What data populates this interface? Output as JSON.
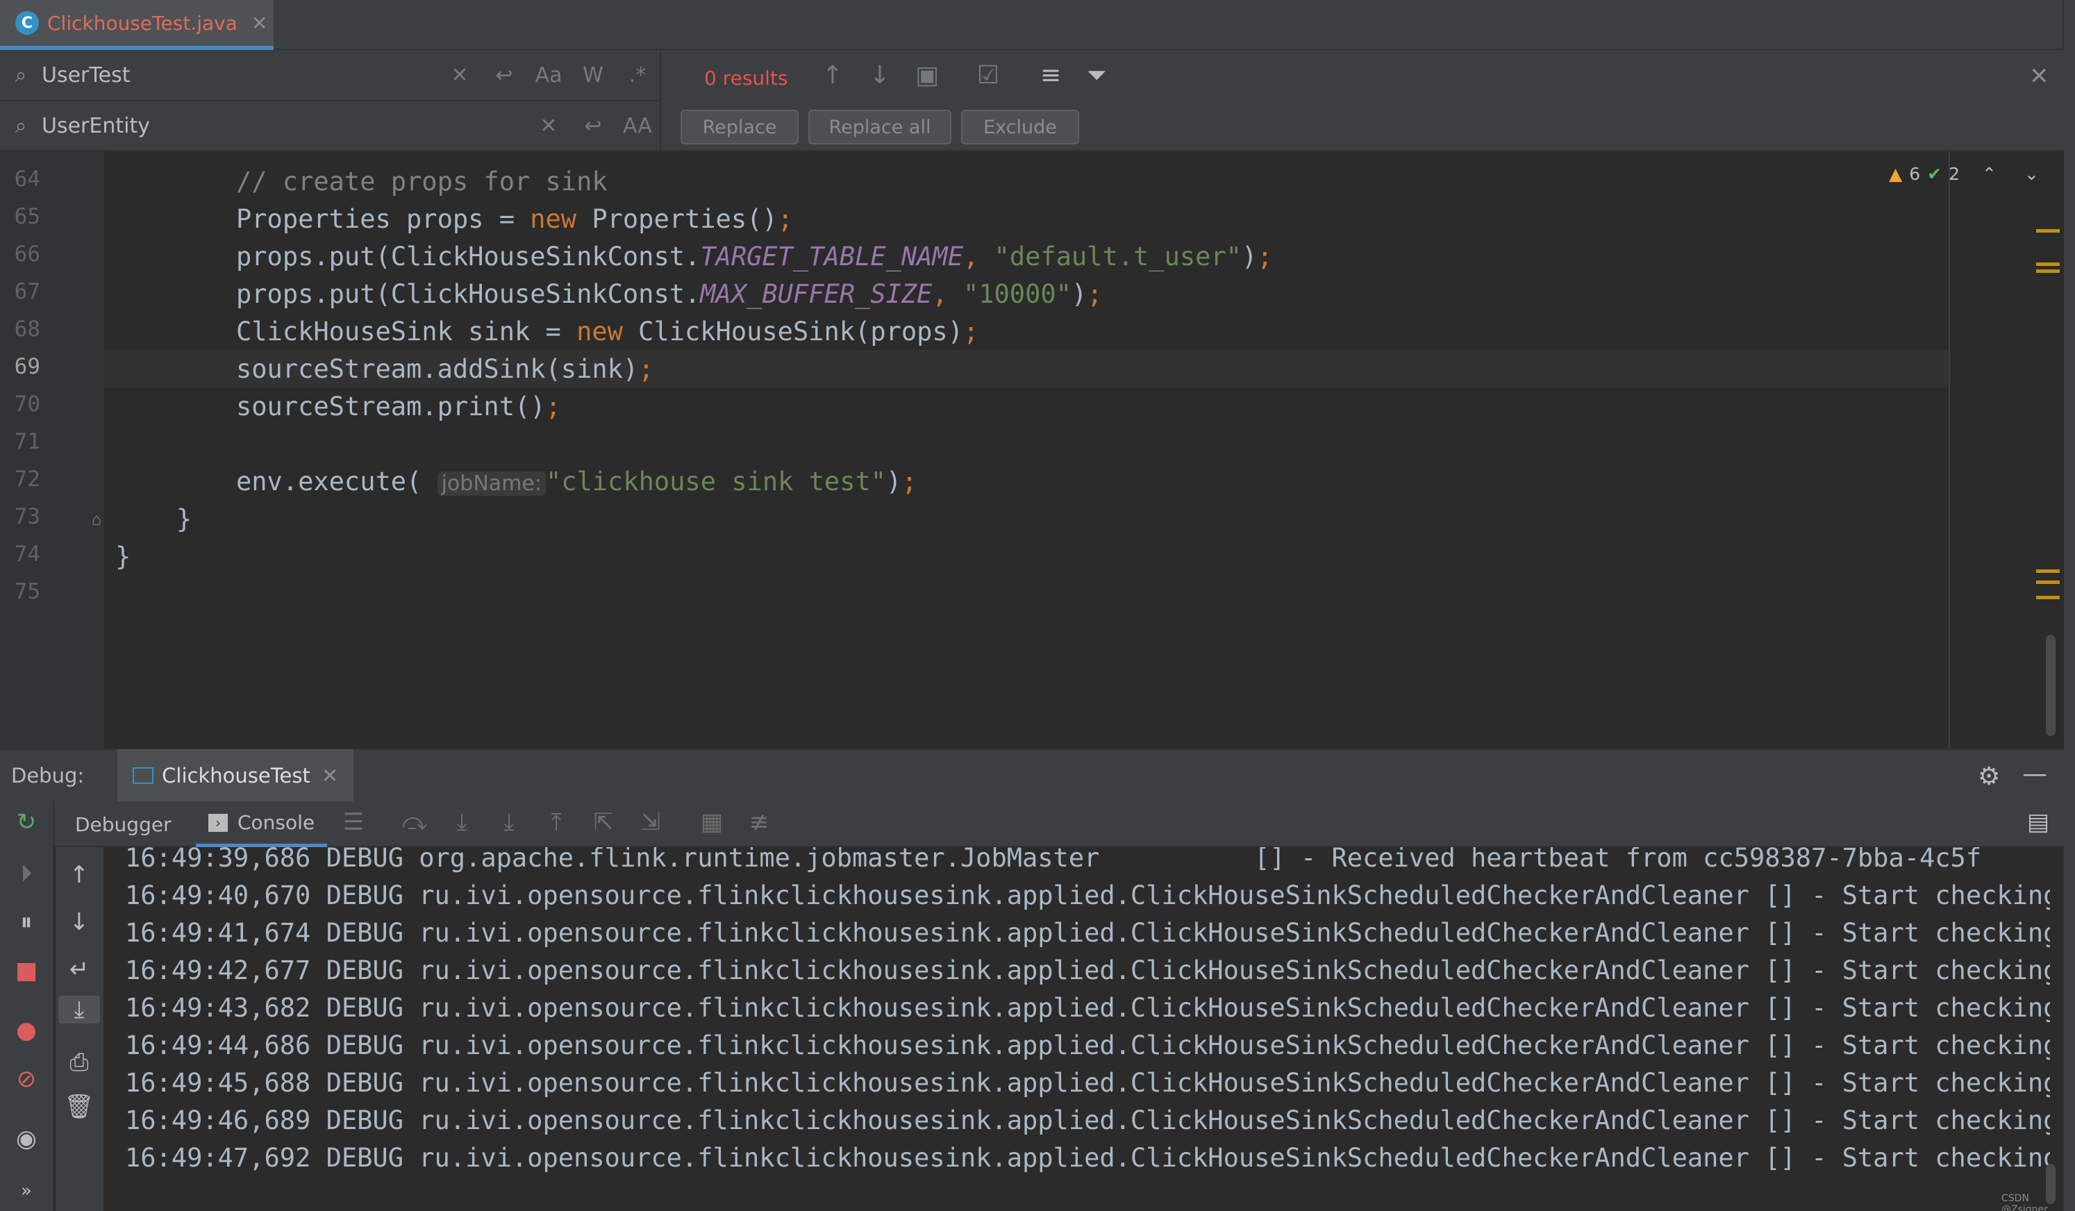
{
  "tab": {
    "icon_letter": "C",
    "title": "ClickhouseTest.java",
    "close": "✕"
  },
  "find": {
    "search_value": "UserTest",
    "replace_value": "UserEntity",
    "match_case": "Aa",
    "words": "W",
    "regex": ".*",
    "preserve_case": "AA",
    "results": "0 results",
    "replace_btn": "Replace",
    "replace_all_btn": "Replace all",
    "exclude_btn": "Exclude"
  },
  "editor": {
    "line_numbers": [
      "64",
      "65",
      "66",
      "67",
      "68",
      "69",
      "70",
      "71",
      "72",
      "73",
      "74",
      "75"
    ],
    "current_line": "69",
    "warnings": "6",
    "checks": "2",
    "lines": {
      "l64_comment": "// create props for sink",
      "l65_a": "Properties props = ",
      "l65_kw": "new",
      "l65_b": " Properties()",
      "l65_semi": ";",
      "l66_a": "props.put(ClickHouseSinkConst.",
      "l66_const": "TARGET_TABLE_NAME",
      "l66_comma": ", ",
      "l66_str": "\"default.t_user\"",
      "l66_b": ")",
      "l66_semi": ";",
      "l67_a": "props.put(ClickHouseSinkConst.",
      "l67_const": "MAX_BUFFER_SIZE",
      "l67_comma": ", ",
      "l67_str": "\"10000\"",
      "l67_b": ")",
      "l67_semi": ";",
      "l68_a": "ClickHouseSink sink = ",
      "l68_kw": "new",
      "l68_b": " ClickHouseSink(props)",
      "l68_semi": ";",
      "l69_a": "sourceStream.addSink(sink)",
      "l69_semi": ";",
      "l70_a": "sourceStream.print()",
      "l70_semi": ";",
      "l72_a": "env.execute(",
      "l72_hint": "jobName:",
      "l72_str": "\"clickhouse sink test\"",
      "l72_b": ")",
      "l72_semi": ";",
      "l73": "}",
      "l74": "}"
    }
  },
  "debug": {
    "label": "Debug:",
    "config_tab": "ClickhouseTest",
    "debugger_tab": "Debugger",
    "console_tab": "Console"
  },
  "console": {
    "lines": [
      "16:49:39,686 DEBUG org.apache.flink.runtime.jobmaster.JobMaster          [] - Received heartbeat from cc598387-7bba-4c5f",
      "16:49:40,670 DEBUG ru.ivi.opensource.flinkclickhousesink.applied.ClickHouseSinkScheduledCheckerAndCleaner [] - Start checking b",
      "16:49:41,674 DEBUG ru.ivi.opensource.flinkclickhousesink.applied.ClickHouseSinkScheduledCheckerAndCleaner [] - Start checking b",
      "16:49:42,677 DEBUG ru.ivi.opensource.flinkclickhousesink.applied.ClickHouseSinkScheduledCheckerAndCleaner [] - Start checking b",
      "16:49:43,682 DEBUG ru.ivi.opensource.flinkclickhousesink.applied.ClickHouseSinkScheduledCheckerAndCleaner [] - Start checking b",
      "16:49:44,686 DEBUG ru.ivi.opensource.flinkclickhousesink.applied.ClickHouseSinkScheduledCheckerAndCleaner [] - Start checking b",
      "16:49:45,688 DEBUG ru.ivi.opensource.flinkclickhousesink.applied.ClickHouseSinkScheduledCheckerAndCleaner [] - Start checking b",
      "16:49:46,689 DEBUG ru.ivi.opensource.flinkclickhousesink.applied.ClickHouseSinkScheduledCheckerAndCleaner [] - Start checking b",
      "16:49:47,692 DEBUG ru.ivi.opensource.flinkclickhousesink.applied.ClickHouseSinkScheduledCheckerAndCleaner [] - Start checking b"
    ]
  },
  "watermark": "CSDN @Zsigner",
  "colors": {
    "accent": "#4a88c7",
    "keyword": "#cc7832",
    "string": "#6a8759",
    "constant": "#9876aa",
    "error": "#e5544c",
    "warning": "#be9117"
  }
}
